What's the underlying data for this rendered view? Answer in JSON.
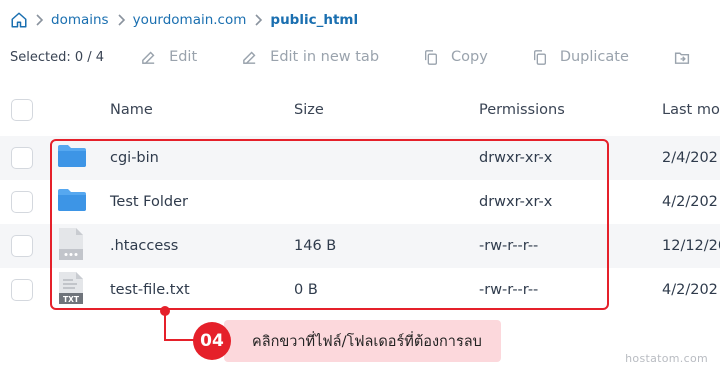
{
  "breadcrumb": {
    "items": [
      "domains",
      "yourdomain.com",
      "public_html"
    ]
  },
  "toolbar": {
    "selected": "Selected: 0 / 4",
    "edit": "Edit",
    "edit_new_tab": "Edit in new tab",
    "copy": "Copy",
    "duplicate": "Duplicate"
  },
  "table": {
    "headers": {
      "name": "Name",
      "size": "Size",
      "permissions": "Permissions",
      "last_modified": "Last mo"
    },
    "rows": [
      {
        "icon": "folder-icon",
        "name": "cgi-bin",
        "size": "",
        "permissions": "drwxr-xr-x",
        "date": "2/4/202"
      },
      {
        "icon": "folder-icon",
        "name": "Test Folder",
        "size": "",
        "permissions": "drwxr-xr-x",
        "date": "4/2/202"
      },
      {
        "icon": "file-icon",
        "name": ".htaccess",
        "size": "146 B",
        "permissions": "-rw-r--r--",
        "date": "12/12/20"
      },
      {
        "icon": "txt-file-icon",
        "name": "test-file.txt",
        "size": "0 B",
        "permissions": "-rw-r--r--",
        "date": "4/2/202"
      }
    ]
  },
  "annotation": {
    "step": "04",
    "text": "คลิกขวาที่ไฟล์/โฟลเดอร์ที่ต้องการลบ",
    "color": "#e5202a"
  },
  "watermark": "hostatom.com"
}
